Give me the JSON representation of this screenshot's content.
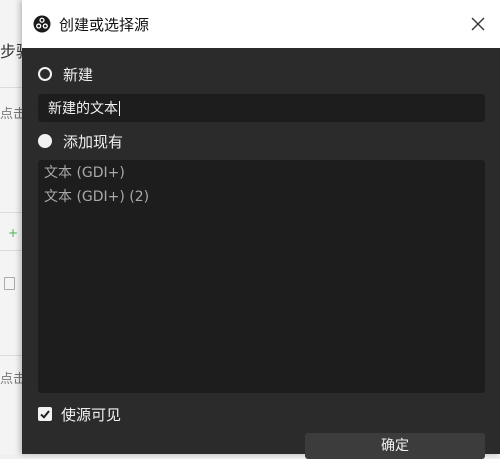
{
  "background": {
    "heading_fragment": "步骤",
    "hint_fragment_1": "点击",
    "hint_fragment_2": "点击"
  },
  "dialog": {
    "title": "创建或选择源",
    "new_option_label": "新建",
    "name_value": "新建的文本",
    "existing_option_label": "添加现有",
    "existing_sources": [
      "文本 (GDI+)",
      "文本 (GDI+) (2)"
    ],
    "visible_label": "使源可见",
    "visible_checked": true,
    "ok_label": "确定"
  },
  "colors": {
    "dialog_bg": "#2b2b2b",
    "field_bg": "#1d1d1d",
    "titlebar_bg": "#ffffff"
  },
  "icons": {
    "app": "obs-logo-icon",
    "close": "close-icon",
    "check": "checkmark-icon"
  }
}
